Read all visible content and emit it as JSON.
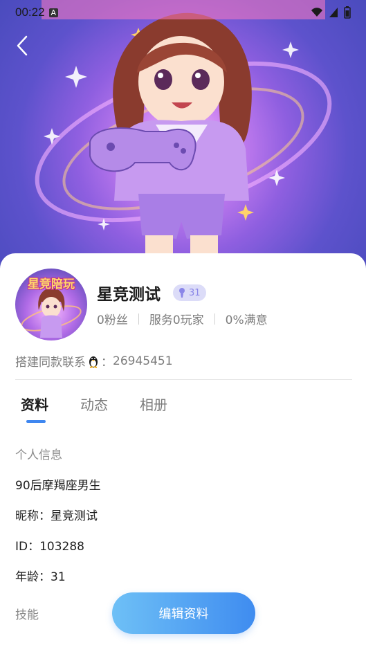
{
  "status_bar": {
    "time": "00:22",
    "badge": "A"
  },
  "profile": {
    "avatar_text": "星竞陪玩",
    "name": "星竞测试",
    "level": "31",
    "stats": [
      "0粉丝",
      "服务0玩家",
      "0%满意"
    ],
    "contact_label": "搭建同款联系",
    "contact_sep": "：",
    "contact_number": "26945451"
  },
  "tabs": [
    {
      "label": "资料",
      "active": true
    },
    {
      "label": "动态",
      "active": false
    },
    {
      "label": "相册",
      "active": false
    }
  ],
  "info": {
    "section_title": "个人信息",
    "bio": "90后摩羯座男生",
    "nickname": "昵称：星竞测试",
    "id": "ID：103288",
    "age": "年龄：31",
    "skills_label": "技能"
  },
  "actions": {
    "edit_label": "编辑资料"
  },
  "colors": {
    "accent": "#3f87f0",
    "button_start": "#6ec0f6",
    "button_end": "#3f8cf0",
    "badge_bg": "#dcdcf8",
    "badge_fg": "#8a86e8"
  },
  "icons": {
    "back": "chevron-left-icon",
    "level": "person-icon",
    "contact": "penguin-icon"
  }
}
